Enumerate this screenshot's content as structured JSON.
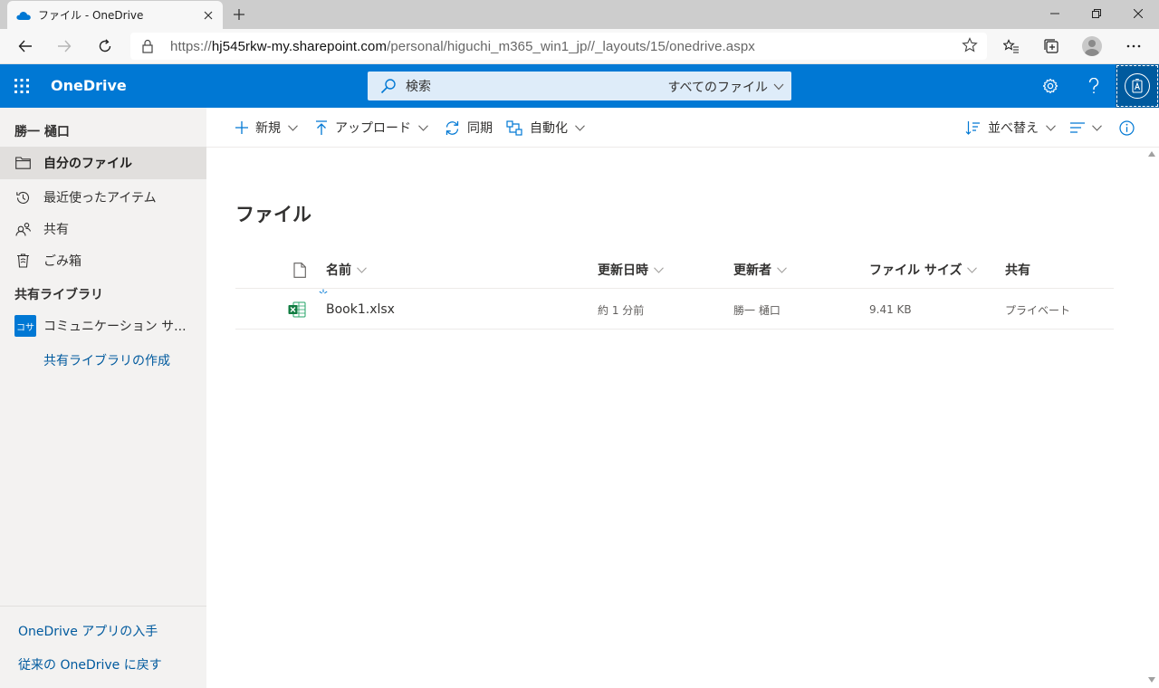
{
  "browser": {
    "tab_title": "ファイル - OneDrive",
    "url_prefix": "https://",
    "url_host": "hj545rkw-my.sharepoint.com",
    "url_path": "/personal/higuchi_m365_win1_jp//_layouts/15/onedrive.aspx"
  },
  "header": {
    "brand": "OneDrive",
    "search_placeholder": "検索",
    "search_scope": "すべてのファイル"
  },
  "leftnav": {
    "user_name": "勝一 樋口",
    "items": [
      {
        "label": "自分のファイル",
        "icon": "folder-icon"
      },
      {
        "label": "最近使ったアイテム",
        "icon": "history-icon"
      },
      {
        "label": "共有",
        "icon": "people-icon"
      },
      {
        "label": "ごみ箱",
        "icon": "trash-icon"
      }
    ],
    "library_heading": "共有ライブラリ",
    "library_badge": "コサ",
    "library_name": "コミュニケーション サ...",
    "create_library": "共有ライブラリの作成",
    "get_app": "OneDrive アプリの入手",
    "return_classic": "従来の OneDrive に戻す"
  },
  "commandbar": {
    "new": "新規",
    "upload": "アップロード",
    "sync": "同期",
    "automate": "自動化",
    "sort": "並べ替え"
  },
  "main": {
    "title": "ファイル",
    "columns": {
      "name": "名前",
      "modified": "更新日時",
      "modified_by": "更新者",
      "size": "ファイル サイズ",
      "sharing": "共有"
    },
    "files": [
      {
        "name": "Book1.xlsx",
        "modified": "約 1 分前",
        "modified_by": "勝一 樋口",
        "size": "9.41 KB",
        "sharing": "プライベート",
        "icon": "excel-icon"
      }
    ]
  },
  "colors": {
    "brand_blue": "#0078d4",
    "nav_bg": "#f3f2f1",
    "link": "#005a9e",
    "excel_green": "#107c41"
  }
}
